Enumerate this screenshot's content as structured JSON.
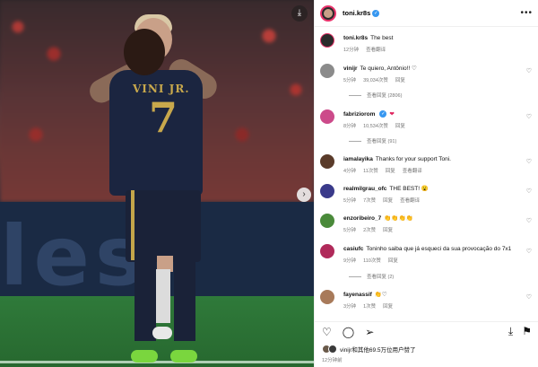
{
  "post": {
    "username": "toni.kr8s",
    "more_icon": "more-horizontal-icon",
    "caption": "The best",
    "caption_time": "12分钟",
    "translate": "查看翻译"
  },
  "media": {
    "jersey_name": "VINI JR.",
    "jersey_number": "7",
    "board_text": "les",
    "download_icon": "download-icon",
    "next_icon": "chevron-right-icon"
  },
  "comments": [
    {
      "user": "vinijr",
      "text": "Te quiero, Antônio!! ♡",
      "time": "5分钟",
      "likes": "39,034次赞",
      "reply": "回复",
      "replies": "查看回复 (2806)",
      "avatar_color": "#8b8b8b"
    },
    {
      "user": "fabriziorom",
      "text": "❤",
      "time": "8分钟",
      "likes": "10,534次赞",
      "reply": "回复",
      "replies": "查看回复 (91)",
      "avatar_color": "#cc4a8a"
    },
    {
      "user": "iamalayika",
      "text": "Thanks for your support Toni.",
      "time": "4分钟",
      "likes": "11次赞",
      "reply": "回复",
      "translate": "查看翻译",
      "avatar_color": "#5a3b2a"
    },
    {
      "user": "realmilgrau_ofc",
      "text": "THE BEST! 😮",
      "time": "5分钟",
      "likes": "7次赞",
      "reply": "回复",
      "translate": "查看翻译",
      "avatar_color": "#3a3a8a"
    },
    {
      "user": "enzoribeiro_7",
      "text": "👏👏👏👏",
      "time": "5分钟",
      "likes": "2次赞",
      "reply": "回复",
      "avatar_color": "#4a8a3a"
    },
    {
      "user": "casiufc",
      "text": "Toninho saiba que já esqueci da sua provocação do 7x1",
      "time": "9分钟",
      "likes": "110次赞",
      "reply": "回复",
      "replies": "查看回复 (2)",
      "avatar_color": "#b02a5a"
    },
    {
      "user": "fayenassif",
      "text": "👏♡",
      "time": "3分钟",
      "likes": "1次赞",
      "reply": "回复",
      "avatar_color": "#a87a5a"
    }
  ],
  "actions": {
    "like_icon": "heart-icon",
    "comment_icon": "comment-icon",
    "share_icon": "share-icon",
    "save_icon": "bookmark-icon",
    "download_icon": "download-icon"
  },
  "likes_text": "vinijr和其他69.5万位用户赞了",
  "post_time": "12分钟前"
}
